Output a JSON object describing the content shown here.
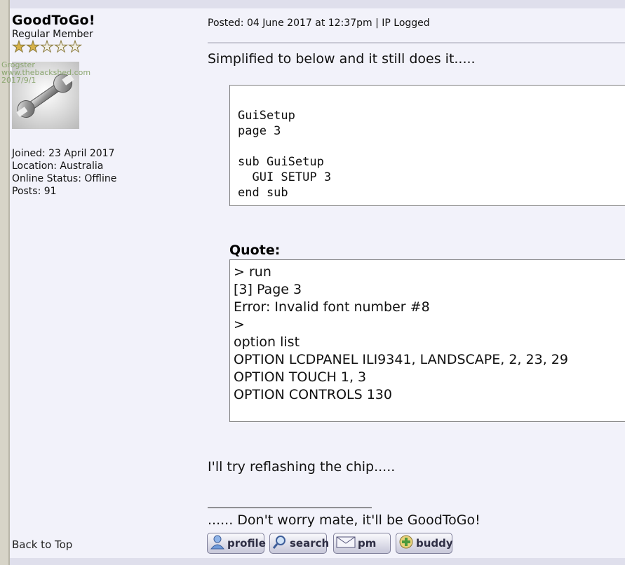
{
  "user": {
    "name": "GoodToGo!",
    "rank": "Regular Member",
    "stars": {
      "filled": 2,
      "total": 5
    },
    "avatar_watermark": [
      "Grogster",
      "www.thebackshed.com",
      "2017/9/1"
    ],
    "joined": "Joined: 23 April 2017",
    "location": "Location: Australia",
    "status": "Online Status: Offline",
    "posts": "Posts: 91"
  },
  "post": {
    "meta": "Posted: 04 June 2017 at 12:37pm | IP Logged",
    "intro": "Simplified to below and it still does it.....",
    "code": "GuiSetup\npage 3\n\nsub GuiSetup\n  GUI SETUP 3\nend sub",
    "quote_label": "Quote:",
    "quote_lines": [
      "> run",
      "[3] Page 3",
      "Error: Invalid font number #8",
      ">",
      "option list",
      "OPTION LCDPANEL ILI9341, LANDSCAPE, 2, 23, 29",
      "OPTION TOUCH 1, 3",
      "OPTION CONTROLS 130"
    ],
    "outro": "I'll try reflashing the chip.....",
    "signature": "...... Don't worry mate, it'll be GoodToGo!"
  },
  "nav": {
    "back_to_top": "Back to Top"
  },
  "buttons": {
    "profile": "profile",
    "search": "search",
    "pm": "pm",
    "buddy": "buddy"
  },
  "colors": {
    "background": "#F2F2FA",
    "rail": "#D7D4C8",
    "button_text": "#2F2F45",
    "star": "#D7B24A"
  }
}
